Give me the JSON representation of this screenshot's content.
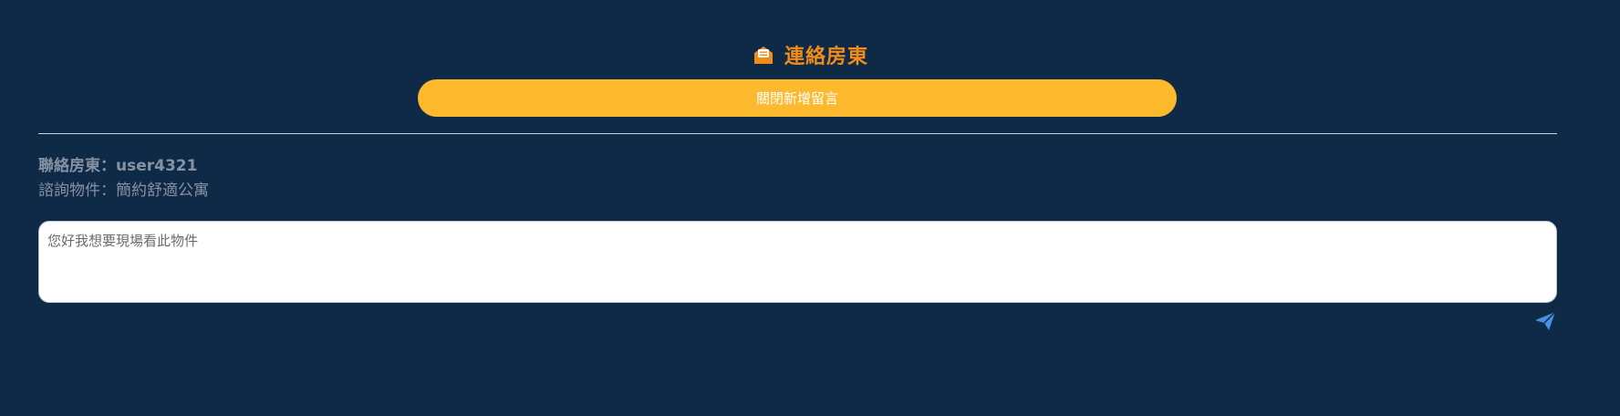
{
  "header": {
    "title": "連絡房東",
    "icon": "envelope-open-icon",
    "title_color": "#f08c1a"
  },
  "toggle_button": {
    "label": "關閉新增留言",
    "color": "#fdb92e"
  },
  "contact_info": {
    "landlord": "聯絡房東：user4321",
    "property": "諮詢物件：簡約舒適公寓"
  },
  "message": {
    "placeholder": "您好我想要現場看此物件",
    "value": ""
  },
  "send_button": {
    "icon": "paper-plane-icon",
    "color": "#4a90e2"
  },
  "colors": {
    "background": "#0f2a47"
  }
}
